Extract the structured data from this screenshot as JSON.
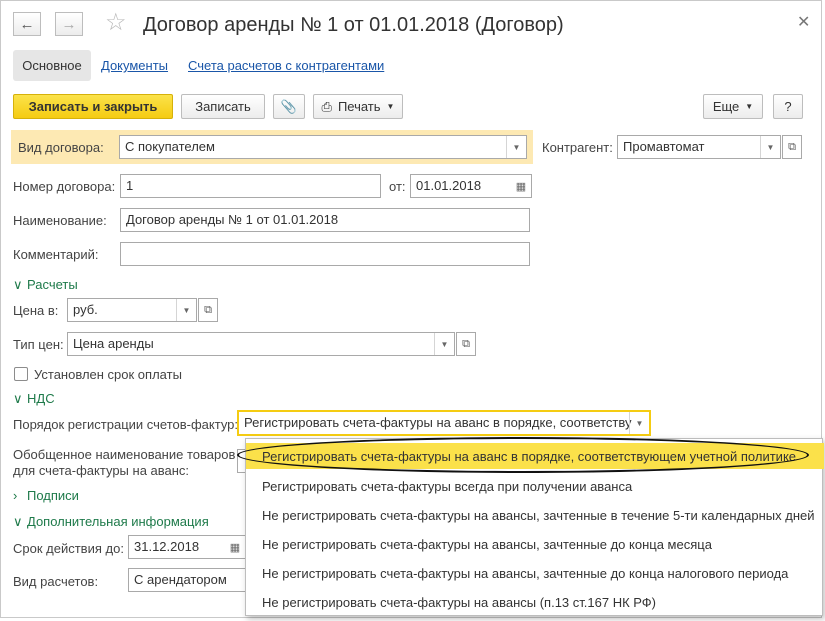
{
  "window": {
    "title": "Договор аренды № 1 от 01.01.2018 (Договор)",
    "back_icon": "arrow-left-icon",
    "forward_icon": "arrow-right-icon",
    "favorite_icon": "star-icon",
    "close_icon": "close-icon"
  },
  "tabs": [
    {
      "label": "Основное"
    },
    {
      "label": "Документы"
    },
    {
      "label": "Счета расчетов с контрагентами"
    }
  ],
  "toolbar": {
    "save_close_label": "Записать и закрыть",
    "save_label": "Записать",
    "attach_icon": "paperclip-icon",
    "print_label": "Печать",
    "more_label": "Еще",
    "help_label": "?"
  },
  "form": {
    "contract_type_label": "Вид договора:",
    "contract_type_value": "С покупателем",
    "counterparty_label": "Контрагент:",
    "counterparty_value": "Промавтомат",
    "number_label": "Номер договора:",
    "number_value": "1",
    "date_label": "от:",
    "date_value": "01.01.2018",
    "name_label": "Наименование:",
    "name_value": "Договор аренды № 1 от 01.01.2018",
    "comment_label": "Комментарий:",
    "comment_value": "",
    "settlements_group": "Расчеты",
    "price_in_label": "Цена в:",
    "price_in_value": "руб.",
    "price_type_label": "Тип цен:",
    "price_type_value": "Цена аренды",
    "payment_term_label": "Установлен срок оплаты",
    "vat_group": "НДС",
    "invoice_order_label": "Порядок регистрации счетов-фактур:",
    "invoice_order_value": "Регистрировать счета-фактуры на аванс в порядке, соответству",
    "generalized_name_label_1": "Обобщенное наименование товаров",
    "generalized_name_label_2": "для счета-фактуры на аванс:",
    "signatures_group": "Подписи",
    "additional_group": "Дополнительная информация",
    "valid_until_label": "Срок действия до:",
    "valid_until_value": "31.12.2018",
    "settlement_kind_label": "Вид расчетов:",
    "settlement_kind_value": "С арендатором"
  },
  "dropdown_options": [
    "Регистрировать счета-фактуры на аванс в порядке, соответствующем учетной политике",
    "Регистрировать счета-фактуры всегда при получении аванса",
    "Не регистрировать счета-фактуры на авансы, зачтенные в течение 5-ти календарных дней",
    "Не регистрировать счета-фактуры на авансы, зачтенные до конца месяца",
    "Не регистрировать счета-фактуры на авансы, зачтенные до конца налогового периода",
    "Не регистрировать счета-фактуры на авансы (п.13 ст.167 НК РФ)"
  ],
  "colors": {
    "accent_yellow": "#f5cc12",
    "highlight_row": "#fde9b3",
    "group_green": "#1e7a4a",
    "link_blue": "#1a56a8"
  }
}
